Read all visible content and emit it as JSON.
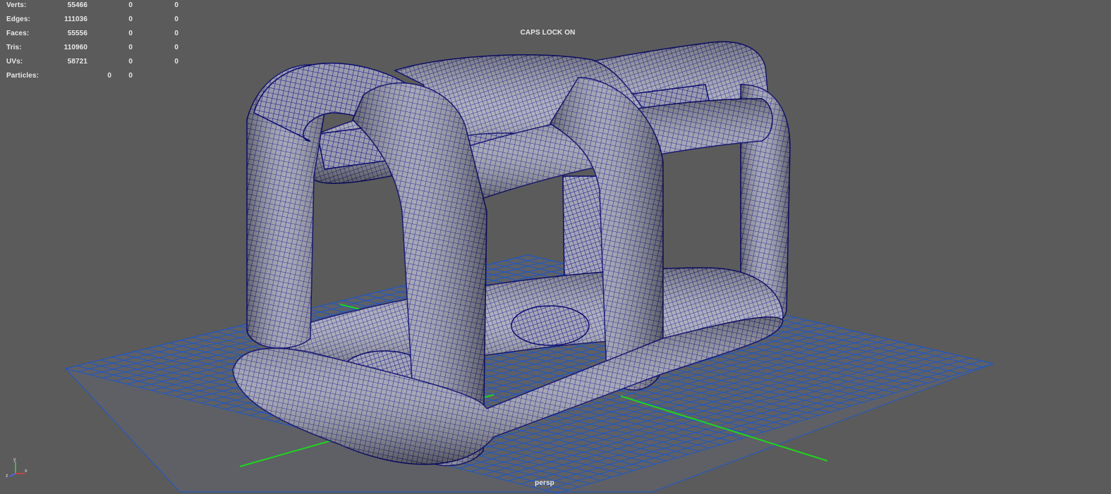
{
  "hud": {
    "stats": [
      {
        "label": "Verts:",
        "a": "55466",
        "b": "0",
        "c": "0"
      },
      {
        "label": "Edges:",
        "a": "111036",
        "b": "0",
        "c": "0"
      },
      {
        "label": "Faces:",
        "a": "55556",
        "b": "0",
        "c": "0"
      },
      {
        "label": "Tris:",
        "a": "110960",
        "b": "0",
        "c": "0"
      },
      {
        "label": "UVs:",
        "a": "58721",
        "b": "0",
        "c": "0"
      }
    ],
    "particles": {
      "label": "Particles:",
      "a": "0",
      "b": "0"
    },
    "caps_lock": "CAPS LOCK ON",
    "camera": "persp"
  },
  "axis": {
    "y": "y",
    "x": "x",
    "z": "z"
  },
  "colors": {
    "background": "#5b5b5b",
    "grid": "#1d57c9",
    "axis_green": "#1fd41f",
    "wireframe": "#10108a",
    "mesh_surface": "#8f93a8"
  },
  "icons": [
    "axis-gizmo-icon"
  ]
}
